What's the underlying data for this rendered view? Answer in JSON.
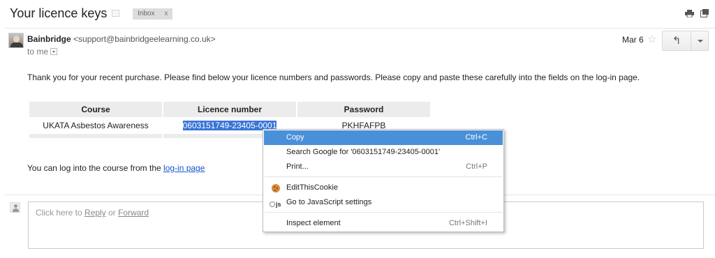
{
  "subject": "Your licence keys",
  "label_chip": {
    "text": "Inbox",
    "close": "x"
  },
  "sender": {
    "name": "Bainbridge",
    "email": "<support@bainbridgeelearning.co.uk>"
  },
  "to_me": "to me",
  "date": "Mar 6",
  "star": "☆",
  "reply_glyph": "↰",
  "body": {
    "intro": "Thank you for your recent purchase. Please find below your licence numbers and passwords. Please copy and paste these carefully into the fields on the log-in page.",
    "table": {
      "headers": [
        "Course",
        "Licence number",
        "Password"
      ],
      "row": {
        "course": "UKATA Asbestos Awareness",
        "licence": "0603151749-23405-0001",
        "password": "PKHFAFPB"
      }
    },
    "login_prefix": "You can log into the course from the ",
    "login_link": "log-in page"
  },
  "reply_box": {
    "prefix": "Click here to ",
    "reply": "Reply",
    "or": " or ",
    "forward": "Forward"
  },
  "context_menu": {
    "items": [
      {
        "label": "Copy",
        "shortcut": "Ctrl+C"
      },
      {
        "label": "Search Google for '0603151749-23405-0001'",
        "shortcut": ""
      },
      {
        "label": "Print...",
        "shortcut": "Ctrl+P"
      },
      {
        "label": "EditThisCookie",
        "shortcut": ""
      },
      {
        "label": "Go to JavaScript settings",
        "shortcut": ""
      },
      {
        "label": "Inspect element",
        "shortcut": "Ctrl+Shift+I"
      }
    ],
    "js_icon_text": "js"
  },
  "colors": {
    "selection": "#3875d7",
    "menu_highlight": "#4a90d9",
    "link": "#1155cc"
  },
  "icons": [
    "print-icon",
    "new-window-icon",
    "star-icon",
    "reply-icon",
    "more-icon",
    "cookie-icon",
    "javascript-icon"
  ]
}
